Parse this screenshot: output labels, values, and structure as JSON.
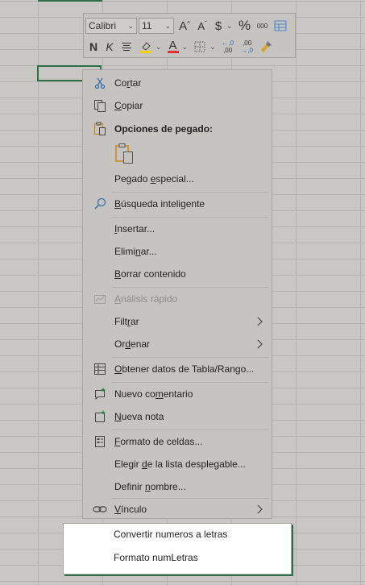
{
  "toolbar": {
    "font_name": "Calibri",
    "font_size": "11",
    "bold_label": "N",
    "italic_label": "K",
    "increase_font_label": "A",
    "decrease_font_label": "A",
    "currency_label": "$",
    "percent_label": "%",
    "thousands_label": "000",
    "increase_decimal_label": "←,0",
    "increase_decimal_sub": ",00",
    "decrease_decimal_label": ",00",
    "decrease_decimal_sub": "→,0",
    "font_color_label": "A",
    "highlight_color": "#f4d400",
    "font_color": "#e0322d"
  },
  "menu": {
    "cut": {
      "pre": "Co",
      "ul": "r",
      "post": "tar"
    },
    "copy": {
      "pre": "",
      "ul": "C",
      "post": "opiar"
    },
    "paste_options": "Opciones de pegado:",
    "paste_special": {
      "pre": "Pegado ",
      "ul": "e",
      "post": "special..."
    },
    "smart_lookup": {
      "pre": "",
      "ul": "B",
      "post": "úsqueda inteligente"
    },
    "insert": {
      "pre": "",
      "ul": "I",
      "post": "nsertar..."
    },
    "delete": {
      "pre": "Elimi",
      "ul": "n",
      "post": "ar..."
    },
    "clear": {
      "pre": "",
      "ul": "B",
      "post": "orrar contenido"
    },
    "quick_analysis": {
      "pre": "",
      "ul": "A",
      "post": "nálisis rápido"
    },
    "filter": {
      "pre": "Filt",
      "ul": "r",
      "post": "ar"
    },
    "sort": {
      "pre": "Or",
      "ul": "d",
      "post": "enar"
    },
    "table_data": {
      "pre": "",
      "ul": "O",
      "post": "btener datos de Tabla/Rango..."
    },
    "new_comment": {
      "pre": "Nuevo co",
      "ul": "m",
      "post": "entario"
    },
    "new_note": {
      "pre": "",
      "ul": "N",
      "post": "ueva nota"
    },
    "format_cells": {
      "pre": "",
      "ul": "F",
      "post": "ormato de celdas..."
    },
    "pick_list": {
      "pre": "Elegir ",
      "ul": "d",
      "post": "e la lista desplegable..."
    },
    "define_name": {
      "pre": "Definir ",
      "ul": "n",
      "post": "ombre..."
    },
    "link": {
      "pre": "",
      "ul": "V",
      "post": "ínculo"
    }
  },
  "addin": {
    "convert": "Convertir numeros a letras",
    "format": "Formato numLetras"
  },
  "icons": {
    "cut": "scissors-icon",
    "copy": "copy-icon",
    "paste": "clipboard-icon",
    "smart_lookup": "magnifier-icon",
    "quick_analysis": "quick-analysis-icon",
    "table_data": "table-icon",
    "comment": "comment-icon",
    "note": "note-icon",
    "format_cells": "format-cells-icon",
    "link": "link-icon"
  }
}
